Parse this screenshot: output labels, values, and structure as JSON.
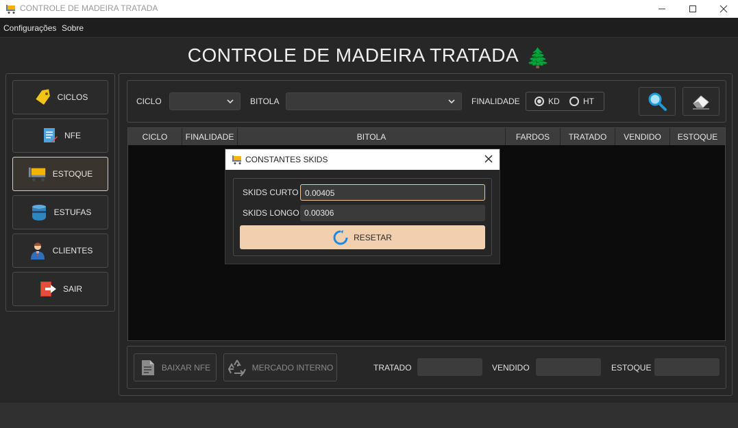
{
  "window": {
    "title": "CONTROLE DE MADEIRA TRATADA",
    "icon": "cart-icon",
    "controls": [
      "minimize",
      "maximize",
      "close"
    ]
  },
  "menubar": {
    "items": [
      "Configurações",
      "Sobre"
    ]
  },
  "header": {
    "title": "CONTROLE DE MADEIRA TRATADA",
    "emoji": "🌲"
  },
  "sidebar": {
    "items": [
      {
        "label": "CICLOS",
        "icon": "tag-icon",
        "active": false
      },
      {
        "label": "NFE",
        "icon": "document-icon",
        "active": false
      },
      {
        "label": "ESTOQUE",
        "icon": "cart-icon",
        "active": true
      },
      {
        "label": "ESTUFAS",
        "icon": "barrel-icon",
        "active": false
      },
      {
        "label": "CLIENTES",
        "icon": "person-icon",
        "active": false
      },
      {
        "label": "SAIR",
        "icon": "exit-icon",
        "active": false
      }
    ]
  },
  "filters": {
    "ciclo_label": "CICLO",
    "ciclo_value": "",
    "bitola_label": "BITOLA",
    "bitola_value": "",
    "finalidade_label": "FINALIDADE",
    "options": [
      {
        "label": "KD",
        "selected": true
      },
      {
        "label": "HT",
        "selected": false
      }
    ],
    "search_icon": "search-icon",
    "clear_icon": "eraser-icon"
  },
  "table": {
    "columns": [
      "CICLO",
      "FINALIDADE",
      "BITOLA",
      "FARDOS",
      "TRATADO",
      "VENDIDO",
      "ESTOQUE"
    ],
    "rows": []
  },
  "bottom": {
    "baixar_label": "BAIXAR NFE",
    "mercado_label": "MERCADO INTERNO",
    "tratado_label": "TRATADO",
    "tratado_value": "",
    "vendido_label": "VENDIDO",
    "vendido_value": "",
    "estoque_label": "ESTOQUE",
    "estoque_value": ""
  },
  "dialog": {
    "title": "CONSTANTES SKIDS",
    "skids_curto_label": "SKIDS CURTO",
    "skids_curto_value": "0.00405",
    "skids_longo_label": "SKIDS LONGO",
    "skids_longo_value": "0.00306",
    "reset_label": "RESETAR"
  },
  "colors": {
    "background": "#272727",
    "accent": "#f2cfae",
    "table_bg": "#0c0c0c"
  }
}
